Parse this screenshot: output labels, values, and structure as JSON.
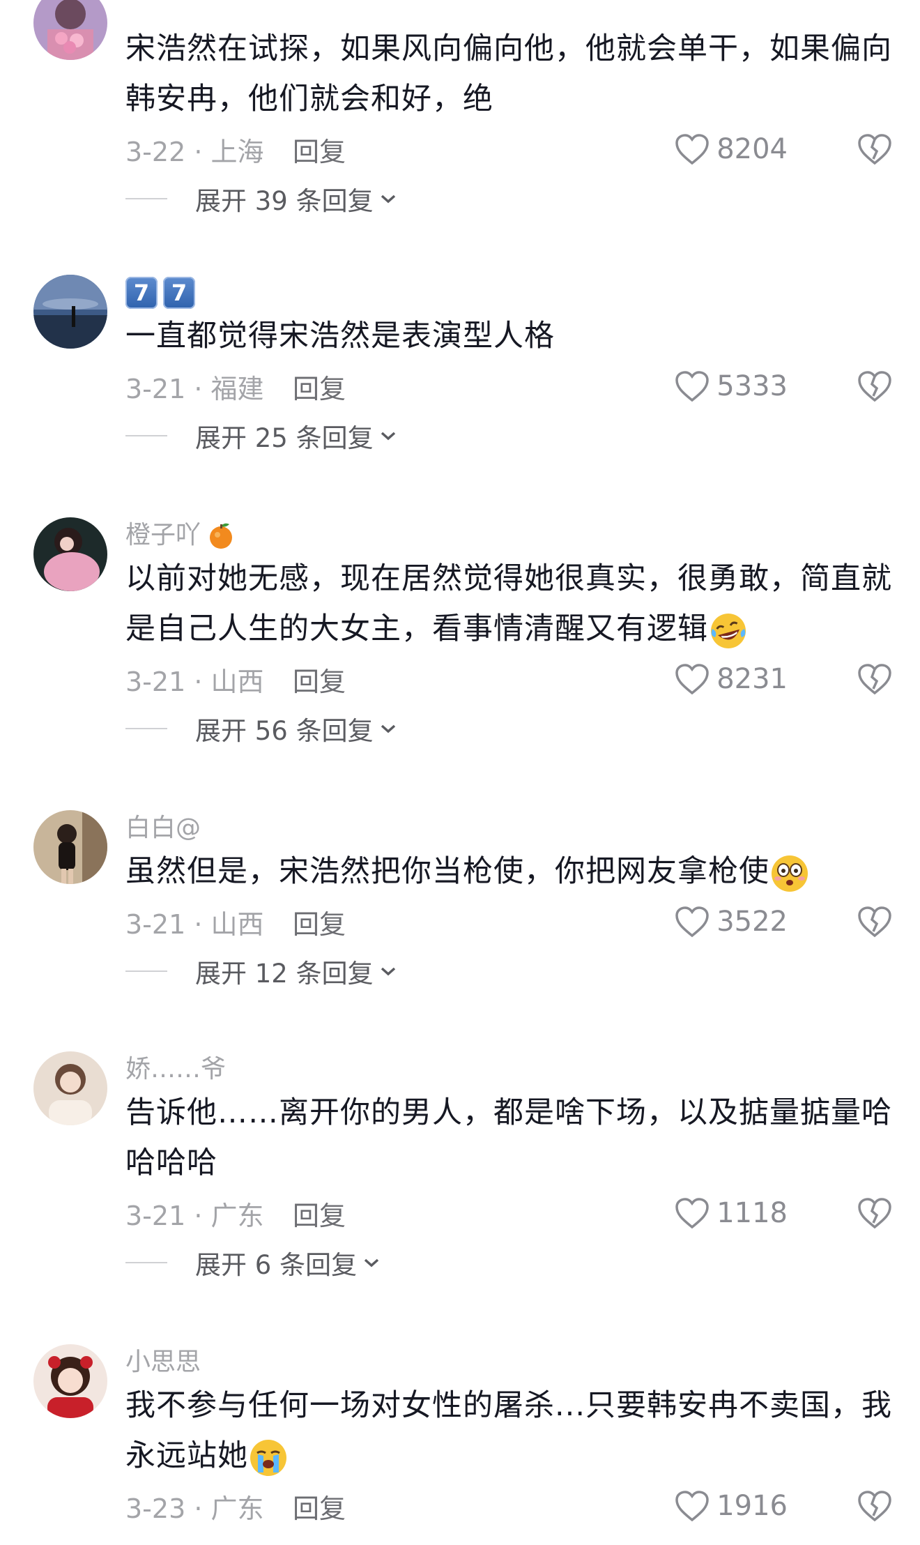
{
  "comments": [
    {
      "username": "",
      "text": "宋浩然在试探，如果风向偏向他，他就会单干，如果偏向韩安冉，他们就会和好，绝",
      "date": "3-22 · 上海",
      "reply_label": "回复",
      "likes": "8204",
      "expand_label": "展开 39 条回复"
    },
    {
      "username_badges": [
        "7",
        "7"
      ],
      "text": "一直都觉得宋浩然是表演型人格",
      "date": "3-21 · 福建",
      "reply_label": "回复",
      "likes": "5333",
      "expand_label": "展开 25 条回复"
    },
    {
      "username": "橙子吖",
      "username_emoji": "orange-emoji",
      "text": "以前对她无感，现在居然觉得她很真实，很勇敢，简直就是自己人生的大女主，看事情清醒又有逻辑",
      "text_emoji": "laughing-tears-emoji",
      "date": "3-21 · 山西",
      "reply_label": "回复",
      "likes": "8231",
      "expand_label": "展开 56 条回复"
    },
    {
      "username": "白白@",
      "text": "虽然但是，宋浩然把你当枪使，你把网友拿枪使",
      "text_emoji": "dizzy-face-emoji",
      "date": "3-21 · 山西",
      "reply_label": "回复",
      "likes": "3522",
      "expand_label": "展开 12 条回复"
    },
    {
      "username": "娇……爷",
      "text": "告诉他……离开你的男人，都是啥下场，以及掂量掂量哈哈哈哈",
      "date": "3-21 · 广东",
      "reply_label": "回复",
      "likes": "1118",
      "expand_label": "展开 6 条回复"
    },
    {
      "username": "小思思",
      "text": "我不参与任何一场对女性的屠杀...只要韩安冉不卖国，我永远站她",
      "text_emoji": "crying-emoji",
      "date": "3-23 · 广东",
      "reply_label": "回复",
      "likes": "1916"
    }
  ],
  "colors": {
    "background": "#ffffff",
    "text": "#161823",
    "meta": "#a3a4a8",
    "expand": "#5a5b60"
  }
}
